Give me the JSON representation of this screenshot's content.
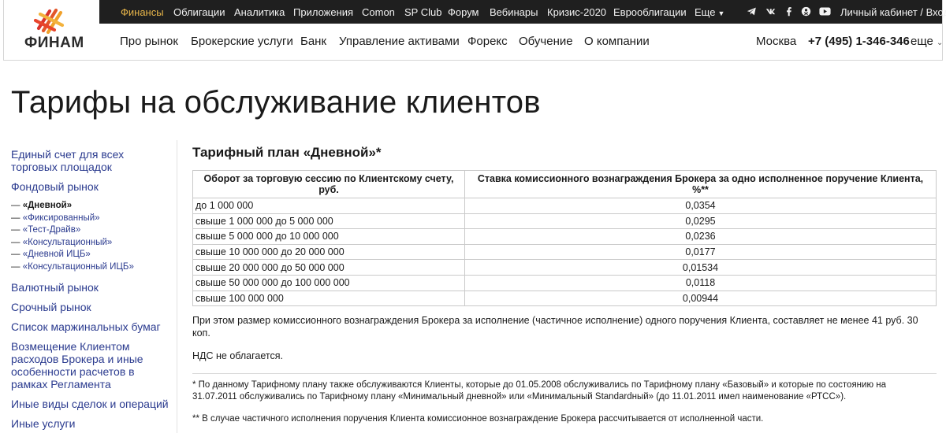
{
  "brand": {
    "name": "ФИНАМ",
    "colors": {
      "accent": "#e8b64a",
      "logo_red": "#d9332b",
      "logo_orange": "#f0a02a",
      "link": "#2b3b8f",
      "topbar_bg": "#1f1f1f"
    }
  },
  "topbar": {
    "items": [
      "Финансы",
      "Облигации",
      "Аналитика",
      "Приложения",
      "Comon",
      "SP Club",
      "Форум",
      "Вебинары",
      "Кризис-2020",
      "Еврооблигации",
      "Еще"
    ],
    "active_index": 0,
    "social_icons": [
      "telegram-icon",
      "vk-icon",
      "facebook-icon",
      "odnoklassniki-icon",
      "youtube-icon"
    ],
    "account_link": "Личный кабинет / Вход"
  },
  "mainnav": {
    "items": [
      "Про рынок",
      "Брокерские услуги",
      "Банк",
      "Управление активами",
      "Форекс",
      "Обучение",
      "О компании"
    ],
    "city": "Москва",
    "phone": "+7 (495) 1-346-346",
    "more": "еще"
  },
  "page": {
    "title": "Тарифы на обслуживание клиентов"
  },
  "sidebar": {
    "links_top": [
      "Единый счет для всех торговых площадок",
      "Фондовый рынок"
    ],
    "sub_items": [
      {
        "label": "«Дневной»",
        "current": true
      },
      {
        "label": "«Фиксированный»",
        "current": false
      },
      {
        "label": "«Тест-Драйв»",
        "current": false
      },
      {
        "label": "«Консультационный»",
        "current": false
      },
      {
        "label": "«Дневной ИЦБ»",
        "current": false
      },
      {
        "label": "«Консультационный ИЦБ»",
        "current": false
      }
    ],
    "sub_prefix": "—",
    "links_bottom": [
      "Валютный рынок",
      "Срочный рынок",
      "Список маржинальных бумаг",
      "Возмещение Клиентом расходов Брокера и иные особенности расчетов в рамках Регламента",
      "Иные виды сделок и операций",
      "Иные услуги"
    ]
  },
  "content": {
    "plan_title": "Тарифный план «Дневной»*",
    "table": {
      "headers": [
        "Оборот за торговую сессию по Клиентскому счету, руб.",
        "Ставка комиссионного вознаграждения Брокера за одно исполненное поручение Клиента, %**"
      ],
      "rows": [
        [
          "до 1 000 000",
          "0,0354"
        ],
        [
          "свыше 1 000 000 до 5 000 000",
          "0,0295"
        ],
        [
          "свыше 5 000 000 до 10 000 000",
          "0,0236"
        ],
        [
          "свыше 10 000 000 до 20 000 000",
          "0,0177"
        ],
        [
          "свыше 20 000 000 до 50 000 000",
          "0,01534"
        ],
        [
          "свыше 50 000 000 до 100 000 000",
          "0,0118"
        ],
        [
          "свыше 100 000 000",
          "0,00944"
        ]
      ]
    },
    "note_min": "При этом размер комиссионного вознаграждения Брокера за исполнение (частичное исполнение) одного поручения Клиента, составляет не менее 41 руб. 30 коп.",
    "note_vat": "НДС не облагается.",
    "footnote_1": "* По данному Тарифному плану также обслуживаются Клиенты, которые до 01.05.2008 обслуживались по Тарифному плану «Базовый» и которые по состоянию на 31.07.2011 обслуживались по Тарифному плану «Минимальный дневной» или «Минимальный Standardный» (до 11.01.2011 имел наименование «РТСС»).",
    "footnote_2": "** В случае частичного исполнения поручения Клиента комиссионное вознаграждение Брокера рассчитывается от исполненной части."
  }
}
